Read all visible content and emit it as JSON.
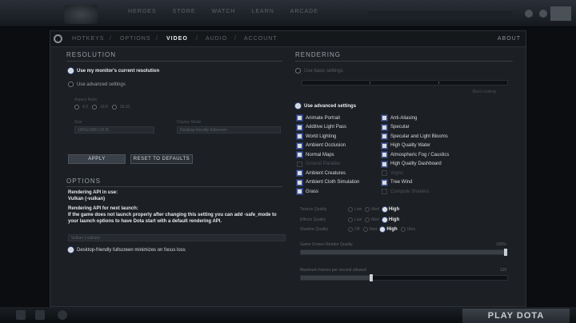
{
  "topbar": {
    "nav": [
      "HEROES",
      "STORE",
      "WATCH",
      "LEARN",
      "ARCADE"
    ]
  },
  "tabs": [
    "HOTKEYS",
    "OPTIONS",
    "VIDEO",
    "AUDIO",
    "ACCOUNT"
  ],
  "tab_separator": "/",
  "active_tab": "VIDEO",
  "about_label": "ABOUT",
  "resolution": {
    "title": "RESOLUTION",
    "use_current": "Use my monitor's current resolution",
    "use_advanced": "Use advanced settings",
    "aspect_label": "Aspect Ratio",
    "aspect_options": [
      "4:3",
      "16:9",
      "16:10"
    ],
    "size_label": "Size",
    "size_value": "1920x1080 (16:9)",
    "display_label": "Display Mode",
    "display_value": "Desktop-friendly fullscreen",
    "apply": "APPLY",
    "reset": "RESET TO DEFAULTS"
  },
  "options": {
    "title": "OPTIONS",
    "api_in_use_label": "Rendering API in use:",
    "api_in_use_value": "Vulkan (-vulkan)",
    "api_next_label": "Rendering API for next launch:",
    "api_note": "If the game does not launch properly after changing this setting you can add -safe_mode to your launch options to have Dota start with a default rendering API.",
    "api_dropdown": "Vulkan (-vulkan)",
    "desktop_minimize": "Desktop-friendly fullscreen minimizes on focus loss"
  },
  "rendering": {
    "title": "RENDERING",
    "use_basic": "Use basic settings",
    "basic_caption": "Best Looking",
    "use_advanced": "Use advanced settings",
    "left_checks": [
      {
        "label": "Animate Portrait",
        "on": true
      },
      {
        "label": "Additive Light Pass",
        "on": true
      },
      {
        "label": "World Lighting",
        "on": true
      },
      {
        "label": "Ambient Occlusion",
        "on": true
      },
      {
        "label": "Normal Maps",
        "on": true
      },
      {
        "label": "Ground Parallax",
        "on": false
      },
      {
        "label": "Ambient Creatures",
        "on": true
      },
      {
        "label": "Ambient Cloth Simulation",
        "on": true
      },
      {
        "label": "Grass",
        "on": true
      }
    ],
    "right_checks": [
      {
        "label": "Anti-Aliasing",
        "on": true
      },
      {
        "label": "Specular",
        "on": true
      },
      {
        "label": "Specular and Light Blooms",
        "on": true
      },
      {
        "label": "High Quality Water",
        "on": true
      },
      {
        "label": "Atmospheric Fog / Caustics",
        "on": true
      },
      {
        "label": "High Quality Dashboard",
        "on": true
      },
      {
        "label": "Vsync",
        "on": false
      },
      {
        "label": "Tree Wind",
        "on": true
      },
      {
        "label": "Compute Shaders",
        "on": false
      }
    ],
    "texture_quality": {
      "label": "Texture Quality",
      "options": [
        "Low",
        "Med",
        "High"
      ],
      "selected": "High"
    },
    "effects_quality": {
      "label": "Effects Quality",
      "options": [
        "Low",
        "Med",
        "High"
      ],
      "selected": "High"
    },
    "shadow_quality": {
      "label": "Shadow Quality",
      "options": [
        "Off",
        "Med",
        "High",
        "Ultra"
      ],
      "selected": "High"
    },
    "render_quality_label": "Game Screen Render Quality",
    "render_quality_value": "100%",
    "render_quality_fraction": 1.0,
    "max_fps_label": "Maximum frames per second allowed",
    "max_fps_value": "120",
    "max_fps_fraction": 0.34
  },
  "play_button": "PLAY DOTA"
}
